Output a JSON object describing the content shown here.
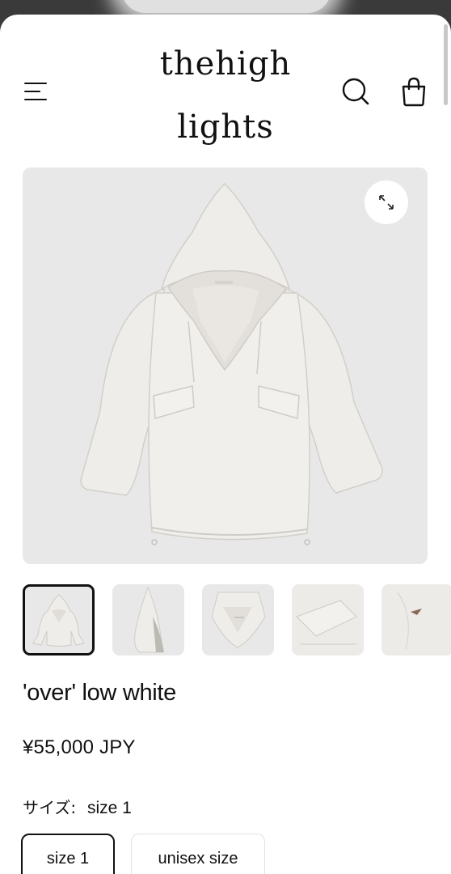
{
  "header": {
    "logo_line1": "thehigh",
    "logo_line2": "lights"
  },
  "product": {
    "title": "'over' low white",
    "price": "¥55,000 JPY",
    "size_label": "サイズ:",
    "size_value": "size 1",
    "size_options": [
      "size 1",
      "unisex size"
    ]
  },
  "colors": {
    "image_bg": "#e8e8e8",
    "garment": "#efedea",
    "text": "#111111"
  }
}
